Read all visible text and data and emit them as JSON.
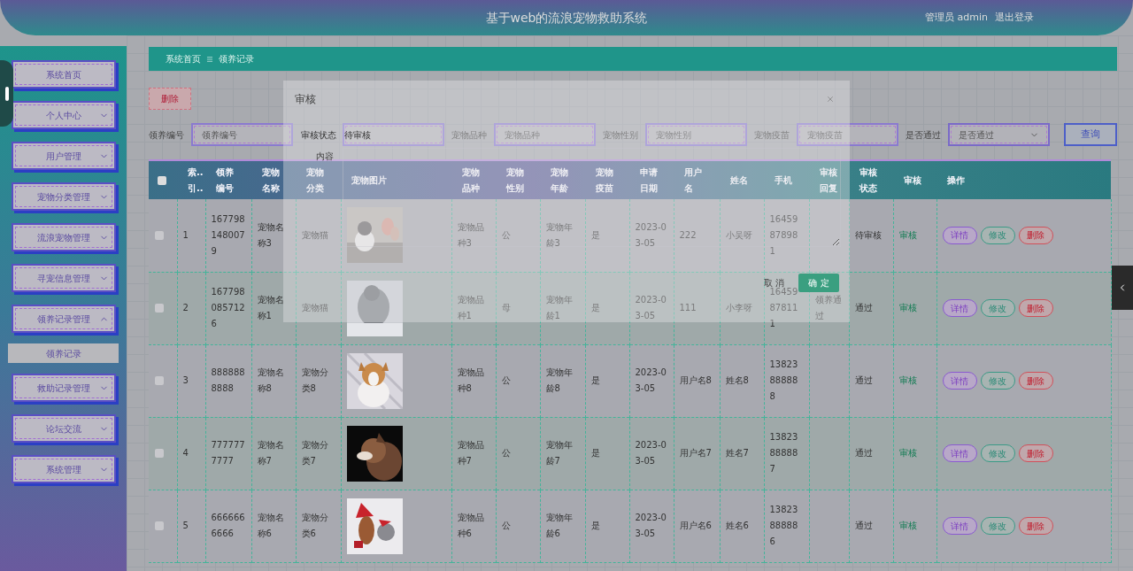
{
  "header": {
    "title": "基于web的流浪宠物救助系统",
    "user": "管理员 admin",
    "logout": "退出登录"
  },
  "sidebar": {
    "items": [
      {
        "kind": "link",
        "label": "系统首页"
      },
      {
        "kind": "menu",
        "label": "个人中心",
        "expanded": false
      },
      {
        "kind": "menu",
        "label": "用户管理",
        "expanded": false
      },
      {
        "kind": "menu",
        "label": "宠物分类管理",
        "expanded": false
      },
      {
        "kind": "menu",
        "label": "流浪宠物管理",
        "expanded": false
      },
      {
        "kind": "menu",
        "label": "寻宠信息管理",
        "expanded": false
      },
      {
        "kind": "menu",
        "label": "领养记录管理",
        "expanded": true,
        "children": [
          {
            "label": "领养记录"
          }
        ]
      },
      {
        "kind": "menu",
        "label": "救助记录管理",
        "expanded": false
      },
      {
        "kind": "menu",
        "label": "论坛交流",
        "expanded": false
      },
      {
        "kind": "menu",
        "label": "系统管理",
        "expanded": false
      }
    ]
  },
  "breadcrumb": [
    "系统首页",
    "领养记录"
  ],
  "toolbar": {
    "delete": "删除"
  },
  "search": {
    "fields": [
      {
        "kind": "input",
        "label": "领养编号",
        "placeholder": "领养编号"
      },
      {
        "kind": "input"
      },
      {
        "kind": "input",
        "label": "宠物品种",
        "placeholder": "宠物品种"
      },
      {
        "kind": "input",
        "label": "宠物性别",
        "placeholder": "宠物性别"
      },
      {
        "kind": "input",
        "label": "宠物疫苗",
        "placeholder": "宠物疫苗"
      },
      {
        "kind": "select",
        "label": "是否通过",
        "placeholder": "是否通过"
      }
    ],
    "button": "查询"
  },
  "table": {
    "select_all": {
      "checked": false
    },
    "columns": [
      "索..引..",
      "领养编号",
      "宠物名称",
      "宠物分类",
      "宠物图片",
      "宠物品种",
      "宠物性别",
      "宠物年龄",
      "宠物疫苗",
      "申请日期",
      "用户名",
      "姓名",
      "手机",
      "审核回复",
      "审核状态",
      "审核",
      "操作"
    ],
    "rows": [
      {
        "selected": false,
        "cells": [
          "1",
          "1677981480079",
          "宠物名称3",
          "宠物猫",
          "",
          "宠物品种3",
          "公",
          "宠物年龄3",
          "是",
          "2023-03-05",
          "222",
          "小吴呀",
          "16459878981",
          "",
          "待审核"
        ],
        "review": "审核",
        "actions": [
          "详情",
          "修改",
          "删除"
        ]
      },
      {
        "selected": false,
        "cells": [
          "2",
          "1677980857126",
          "宠物名称1",
          "宠物猫",
          "",
          "宠物品种1",
          "母",
          "宠物年龄1",
          "是",
          "2023-03-05",
          "111",
          "小李呀",
          "16459878111",
          "领养通过",
          "通过"
        ],
        "review": "审核",
        "actions": [
          "详情",
          "修改",
          "删除"
        ]
      },
      {
        "selected": false,
        "cells": [
          "3",
          "8888888888",
          "宠物名称8",
          "宠物分类8",
          "",
          "宠物品种8",
          "公",
          "宠物年龄8",
          "是",
          "2023-03-05",
          "用户名8",
          "姓名8",
          "13823888888",
          "",
          "通过"
        ],
        "review": "审核",
        "actions": [
          "详情",
          "修改",
          "删除"
        ]
      },
      {
        "selected": false,
        "cells": [
          "4",
          "7777777777",
          "宠物名称7",
          "宠物分类7",
          "",
          "宠物品种7",
          "公",
          "宠物年龄7",
          "是",
          "2023-03-05",
          "用户名7",
          "姓名7",
          "13823888887",
          "",
          "通过"
        ],
        "review": "审核",
        "actions": [
          "详情",
          "修改",
          "删除"
        ]
      },
      {
        "selected": false,
        "cells": [
          "5",
          "6666666666",
          "宠物名称6",
          "宠物分类6",
          "",
          "宠物品种6",
          "公",
          "宠物年龄6",
          "是",
          "2023-03-05",
          "用户名6",
          "姓名6",
          "13823888886",
          "",
          "通过"
        ],
        "review": "审核",
        "actions": [
          "详情",
          "修改",
          "删除"
        ]
      }
    ]
  },
  "dialog": {
    "title": "审核",
    "status_label": "审核状态",
    "status_value": "待审核",
    "content_label": "内容",
    "cancel": "取 消",
    "confirm": "确 定"
  }
}
